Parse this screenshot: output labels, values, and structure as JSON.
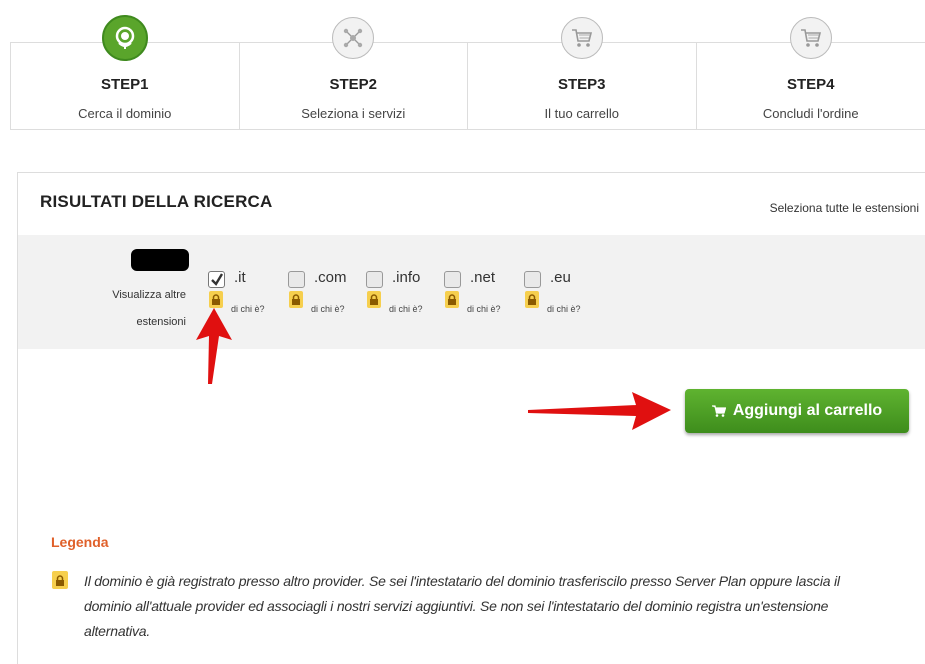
{
  "steps": [
    {
      "title": "STEP1",
      "subtitle": "Cerca il dominio",
      "icon": "globe-icon",
      "active": true
    },
    {
      "title": "STEP2",
      "subtitle": "Seleziona i servizi",
      "icon": "network-icon",
      "active": false
    },
    {
      "title": "STEP3",
      "subtitle": "Il tuo carrello",
      "icon": "cart-icon",
      "active": false
    },
    {
      "title": "STEP4",
      "subtitle": "Concludi l'ordine",
      "icon": "cart-icon",
      "active": false
    }
  ],
  "results": {
    "title": "RISULTATI DELLA RICERCA",
    "select_all": "Seleziona tutte le estensioni",
    "show_label": "Visualizza altre estensioni",
    "extensions": [
      {
        "name": ".it",
        "checked": true,
        "whois": "di chi è?"
      },
      {
        "name": ".com",
        "checked": false,
        "whois": "di chi è?"
      },
      {
        "name": ".info",
        "checked": false,
        "whois": "di chi è?"
      },
      {
        "name": ".net",
        "checked": false,
        "whois": "di chi è?"
      },
      {
        "name": ".eu",
        "checked": false,
        "whois": "di chi è?"
      }
    ],
    "add_to_cart": "Aggiungi al carrello"
  },
  "legend": {
    "title": "Legenda",
    "text": "Il dominio è già registrato presso altro provider. Se sei l'intestatario del dominio trasferiscilo presso Server Plan oppure lascia il dominio all'attuale provider ed associagli i nostri servizi aggiuntivi. Se non sei l'intestatario del dominio registra un'estensione alternativa."
  },
  "colors": {
    "accent_green": "#4fa126",
    "legend_orange": "#e0602a",
    "lock_yellow": "#f6cf4e",
    "annotation_red": "#e01010"
  }
}
